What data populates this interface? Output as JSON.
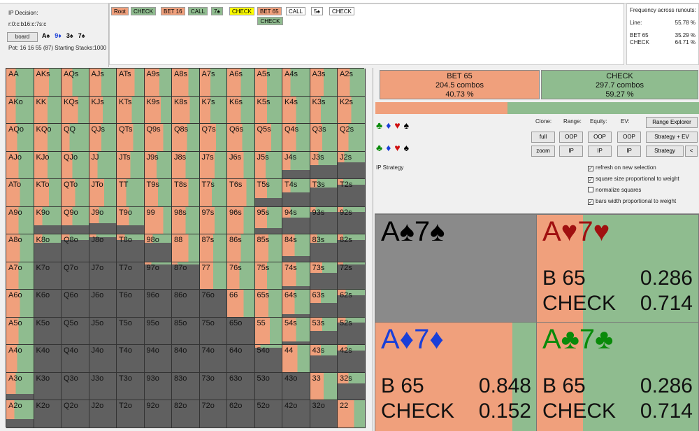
{
  "info": {
    "decision": "IP Decision:",
    "line": "r:0:c:b16:c:7s:c",
    "board_label": "board",
    "board_cards": [
      {
        "text": "A♠",
        "color": "#000000"
      },
      {
        "text": "9♦",
        "color": "#1a3fd8"
      },
      {
        "text": "3♠",
        "color": "#000000"
      },
      {
        "text": "7♠",
        "color": "#000000"
      }
    ],
    "pot": "Pot: 16 16 55 (87) Starting Stacks:1000"
  },
  "tree": {
    "row1": [
      {
        "label": "Root",
        "bg": "#f0a07c"
      },
      {
        "label": "CHECK",
        "bg": "#8fbc8f"
      },
      {
        "label": "BET 16",
        "bg": "#f0a07c"
      },
      {
        "label": "CALL",
        "bg": "#8fbc8f"
      },
      {
        "label": "7♠",
        "bg": "#8fbc8f"
      },
      {
        "label": "CHECK",
        "bg": "#ffff00"
      },
      {
        "label": "BET 65",
        "bg": "#f0a07c"
      },
      {
        "label": "CALL",
        "bg": "#ffffff"
      },
      {
        "label": "5♠",
        "bg": "#ffffff"
      },
      {
        "label": "CHECK",
        "bg": "#ffffff"
      }
    ],
    "row2": [
      {
        "label": "CHECK",
        "bg": "#8fbc8f"
      }
    ]
  },
  "frequency": {
    "title": "Frequency across runouts:",
    "line_label": "Line:",
    "line_value": "55.78 %",
    "rows": [
      {
        "label": "BET 65",
        "value": "35.29 %"
      },
      {
        "label": "CHECK",
        "value": "64.71 %"
      }
    ]
  },
  "colors": {
    "bet": "#f0a07c",
    "check": "#8fbc8f",
    "empty": "#606060"
  },
  "grid": {
    "ranks": [
      "A",
      "K",
      "Q",
      "J",
      "T",
      "9",
      "8",
      "7",
      "6",
      "5",
      "4",
      "3",
      "2"
    ],
    "bet_fraction_rows": [
      [
        0.35,
        0.55,
        0.4,
        0.45,
        0.65,
        0.55,
        0.6,
        0.4,
        0.5,
        0.45,
        0.3,
        0.5,
        0.45
      ],
      [
        0.35,
        0.5,
        0.6,
        0.5,
        0.55,
        0.6,
        0.65,
        0.4,
        0.5,
        0.45,
        0.5,
        0.4,
        0.5
      ],
      [
        0.4,
        0.5,
        0.3,
        0.45,
        0.6,
        0.7,
        0.55,
        0.6,
        0.55,
        0.6,
        0.5,
        0.45,
        0.4
      ],
      [
        0.45,
        0.5,
        0.4,
        0.3,
        0.5,
        0.45,
        0.5,
        0.55,
        0.6,
        0.4,
        0.3,
        0.3,
        0.25
      ],
      [
        0.5,
        0.55,
        0.5,
        0.55,
        0.35,
        0.5,
        0.6,
        0.45,
        0.7,
        0.45,
        0.3,
        0.25,
        0.2
      ],
      [
        0.45,
        0.3,
        0.4,
        0.35,
        0.45,
        0.7,
        0.5,
        0.55,
        0.6,
        0.45,
        0.3,
        0.2,
        0.2
      ],
      [
        0.5,
        0.3,
        0.3,
        0.25,
        0.3,
        0.3,
        0.6,
        0.5,
        0.5,
        0.5,
        0.45,
        0.25,
        0.2
      ],
      [
        0.45,
        0.2,
        0.2,
        0.2,
        0.2,
        0.25,
        0.2,
        0.5,
        0.45,
        0.45,
        0.5,
        0.45,
        0.2
      ],
      [
        0.5,
        0.2,
        0.2,
        0.2,
        0.2,
        0.2,
        0.2,
        0.2,
        0.6,
        0.5,
        0.45,
        0.4,
        0.3
      ],
      [
        0.45,
        0.2,
        0.2,
        0.2,
        0.2,
        0.2,
        0.2,
        0.2,
        0.2,
        0.55,
        0.5,
        0.45,
        0.3
      ],
      [
        0.4,
        0.2,
        0.2,
        0.2,
        0.2,
        0.2,
        0.2,
        0.2,
        0.2,
        0.2,
        0.55,
        0.4,
        0.35
      ],
      [
        0.35,
        0.2,
        0.2,
        0.2,
        0.2,
        0.2,
        0.2,
        0.2,
        0.2,
        0.2,
        0.2,
        0.5,
        0.4
      ],
      [
        0.3,
        0.2,
        0.2,
        0.2,
        0.2,
        0.2,
        0.2,
        0.2,
        0.2,
        0.2,
        0.2,
        0.2,
        0.6
      ]
    ],
    "weight_rows": [
      [
        1,
        1,
        1,
        1,
        1,
        1,
        1,
        1,
        1,
        1,
        1,
        1,
        1
      ],
      [
        1,
        1,
        1,
        1,
        1,
        1,
        1,
        1,
        1,
        1,
        1,
        1,
        1
      ],
      [
        1,
        1,
        1,
        1,
        1,
        1,
        1,
        1,
        1,
        1,
        1,
        1,
        1
      ],
      [
        1,
        1,
        1,
        1,
        1,
        1,
        1,
        1,
        1,
        1,
        0.7,
        0.5,
        0.4
      ],
      [
        1,
        1,
        1,
        1,
        1,
        1,
        1,
        1,
        1,
        0.7,
        0.5,
        0.3,
        0.2
      ],
      [
        1,
        0.7,
        0.7,
        0.6,
        0.7,
        1,
        1,
        1,
        1,
        0.8,
        0.4,
        0.2,
        0.2
      ],
      [
        1,
        0.3,
        0.2,
        0.1,
        0.2,
        0.3,
        1,
        1,
        1,
        1,
        0.8,
        0.3,
        0.2
      ],
      [
        1,
        0,
        0,
        0,
        0,
        0.1,
        0.1,
        1,
        1,
        1,
        0.9,
        0.4,
        0.1
      ],
      [
        1,
        0,
        0,
        0,
        0,
        0,
        0,
        0,
        1,
        1,
        0.9,
        0.5,
        0.2
      ],
      [
        1,
        0,
        0,
        0,
        0,
        0,
        0,
        0,
        0,
        1,
        0.9,
        0.5,
        0.2
      ],
      [
        1,
        0,
        0,
        0,
        0,
        0,
        0,
        0,
        0,
        0.1,
        1,
        0.4,
        0.2
      ],
      [
        0.8,
        0,
        0,
        0,
        0,
        0,
        0,
        0,
        0,
        0,
        0,
        1,
        0.4
      ],
      [
        0.7,
        0,
        0,
        0,
        0,
        0,
        0,
        0,
        0,
        0,
        0,
        0,
        1
      ]
    ]
  },
  "strategy": {
    "bet": {
      "label": "BET 65",
      "combos": "204.5 combos",
      "pct": "40.73 %"
    },
    "check": {
      "label": "CHECK",
      "combos": "297.7 combos",
      "pct": "59.27 %"
    },
    "bet_fraction": 0.4073
  },
  "suits": {
    "row1": [
      {
        "g": "♣",
        "c": "#0a8a0a"
      },
      {
        "g": "♦",
        "c": "#1a3fd8"
      },
      {
        "g": "♥",
        "c": "#d01010"
      },
      {
        "g": "♠",
        "c": "#000000"
      }
    ],
    "row2": [
      {
        "g": "♣",
        "c": "#0a8a0a"
      },
      {
        "g": "♦",
        "c": "#1a3fd8"
      },
      {
        "g": "♥",
        "c": "#d01010"
      },
      {
        "g": "♠",
        "c": "#000000"
      }
    ]
  },
  "controls": {
    "clone": "Clone:",
    "range": "Range:",
    "equity": "Equity:",
    "ev": "EV:",
    "full": "full",
    "zoom": "zoom",
    "oop": "OOP",
    "ip": "IP",
    "range_explorer": "Range Explorer",
    "strategy_ev": "Strategy + EV",
    "strategy": "Strategy",
    "back": "<",
    "ip_strategy": "IP Strategy",
    "checks": [
      {
        "label": "refresh on new selection",
        "checked": true
      },
      {
        "label": "square size proportional to weight",
        "checked": true
      },
      {
        "label": "normalize squares",
        "checked": false
      },
      {
        "label": "bars width proportional to weight",
        "checked": true
      }
    ]
  },
  "combos": [
    {
      "title": "A♠7♠",
      "color": "#000000",
      "bet_fraction": 0,
      "bet_label": "",
      "bet_value": "",
      "check_label": "",
      "check_value": "",
      "empty": true
    },
    {
      "title": "A♥7♥",
      "color": "#a01010",
      "bet_fraction": 0.286,
      "bet_label": "B 65",
      "bet_value": "0.286",
      "check_label": "CHECK",
      "check_value": "0.714",
      "empty": false
    },
    {
      "title": "A♦7♦",
      "color": "#1a3fd8",
      "bet_fraction": 0.848,
      "bet_label": "B 65",
      "bet_value": "0.848",
      "check_label": "CHECK",
      "check_value": "0.152",
      "empty": false
    },
    {
      "title": "A♣7♣",
      "color": "#0a8a0a",
      "bet_fraction": 0.286,
      "bet_label": "B 65",
      "bet_value": "0.286",
      "check_label": "CHECK",
      "check_value": "0.714",
      "empty": false
    }
  ]
}
